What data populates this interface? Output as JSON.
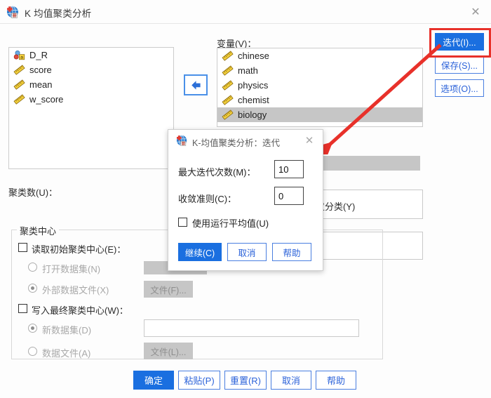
{
  "window": {
    "title": "K 均值聚类分析",
    "icon": "spss-kmeans-icon",
    "close": "✕"
  },
  "source_list": {
    "items": [
      {
        "label": "D_R",
        "icon": "nominal-string-icon",
        "selected": false
      },
      {
        "label": "score",
        "icon": "scale-ruler-icon",
        "selected": false
      },
      {
        "label": "mean",
        "icon": "scale-ruler-icon",
        "selected": false
      },
      {
        "label": "w_score",
        "icon": "scale-ruler-icon",
        "selected": false
      }
    ]
  },
  "transfer": {
    "arrow": "⬅",
    "name": "move-left-arrow"
  },
  "variables": {
    "label": "变量(V)：",
    "items": [
      {
        "label": "chinese",
        "icon": "scale-ruler-icon",
        "selected": false
      },
      {
        "label": "math",
        "icon": "scale-ruler-icon",
        "selected": false
      },
      {
        "label": "physics",
        "icon": "scale-ruler-icon",
        "selected": false
      },
      {
        "label": "chemist",
        "icon": "scale-ruler-icon",
        "selected": false
      },
      {
        "label": "biology",
        "icon": "scale-ruler-icon",
        "selected": true
      }
    ]
  },
  "side_buttons": [
    {
      "label": "迭代(I)...",
      "primary": true
    },
    {
      "label": "保存(S)...",
      "primary": false
    },
    {
      "label": "选项(O)...",
      "primary": false
    }
  ],
  "cluster_count": {
    "label": "聚类数(U)：",
    "value": ""
  },
  "method": {
    "label_partial": "仅分类(Y)"
  },
  "cluster_center": {
    "group_label": "聚类中心",
    "read_initial": {
      "label": "读取初始聚类中心(E)：",
      "checked": false
    },
    "open_dataset": {
      "label": "打开数据集(N)",
      "selected": false
    },
    "external_file": {
      "label": "外部数据文件(X)",
      "selected": true
    },
    "file_button_f": "文件(F)...",
    "write_final": {
      "label": "写入最终聚类中心(W)：",
      "checked": false
    },
    "new_dataset": {
      "label": "新数据集(D)",
      "selected": true,
      "value": ""
    },
    "data_file": {
      "label": "数据文件(A)",
      "selected": false
    },
    "file_button_l": "文件(L)..."
  },
  "bottom_buttons": [
    {
      "label": "确定",
      "primary": true
    },
    {
      "label": "粘贴(P)",
      "primary": false
    },
    {
      "label": "重置(R)",
      "primary": false
    },
    {
      "label": "取消",
      "primary": false
    },
    {
      "label": "帮助",
      "primary": false
    }
  ],
  "iteration_dialog": {
    "title": "K-均值聚类分析：迭代",
    "icon": "spss-kmeans-icon",
    "close": "✕",
    "max_iterations": {
      "label": "最大迭代次数(M)：",
      "value": "10"
    },
    "convergence": {
      "label": "收敛准则(C)：",
      "value": "0"
    },
    "running_means": {
      "label": "使用运行平均值(U)",
      "checked": false
    },
    "buttons": [
      {
        "label": "继续(C)",
        "primary": true
      },
      {
        "label": "取消",
        "primary": false
      },
      {
        "label": "帮助",
        "primary": false
      }
    ]
  },
  "annotation": {
    "box_color": "#e8312a",
    "arrow_color": "#e8312a"
  }
}
